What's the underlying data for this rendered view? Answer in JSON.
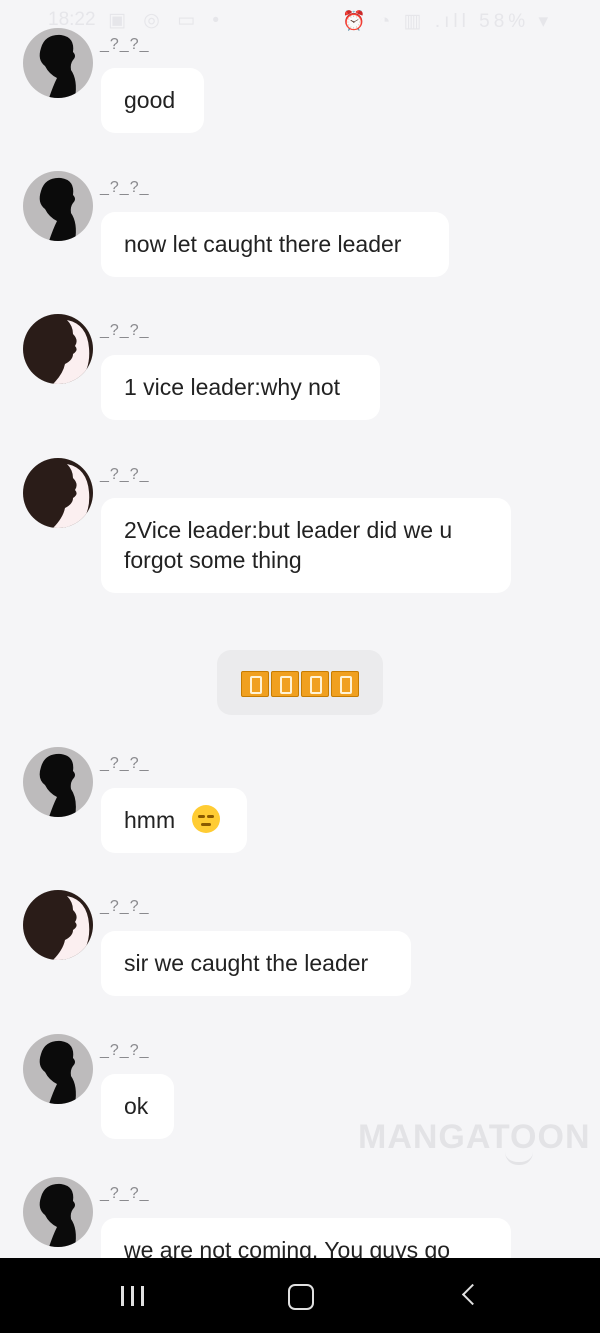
{
  "status_bar": {
    "time": "18:22",
    "battery": "58%"
  },
  "messages": [
    {
      "sender": "_?_?_",
      "text": "good",
      "avatar": "silhouette-light-avatar"
    },
    {
      "sender": "_?_?_",
      "text": "now let caught there leader",
      "avatar": "silhouette-light-avatar"
    },
    {
      "sender": "_?_?_",
      "text": "1 vice leader:why not",
      "avatar": "silhouette-dark-avatar"
    },
    {
      "sender": "_?_?_",
      "text": "2Vice leader:but leader did we u forgot some thing",
      "avatar": "silhouette-dark-avatar"
    },
    {
      "sender": "_?_?_",
      "text": "hmm",
      "avatar": "silhouette-light-avatar",
      "emoji": "unamused-face"
    },
    {
      "sender": "_?_?_",
      "text": "sir we caught the leader",
      "avatar": "silhouette-dark-avatar"
    },
    {
      "sender": "_?_?_",
      "text": "ok",
      "avatar": "silhouette-light-avatar"
    },
    {
      "sender": "_?_?_",
      "text": "we are not coming. You guys go",
      "avatar": "silhouette-light-avatar"
    }
  ],
  "divider": {
    "icon": "vibration-chips"
  },
  "watermark": "MANGATOON",
  "colors": {
    "background": "#f5f5f7",
    "bubble": "#ffffff",
    "divider_chip": "#f0a020",
    "nav_bar": "#000000"
  }
}
